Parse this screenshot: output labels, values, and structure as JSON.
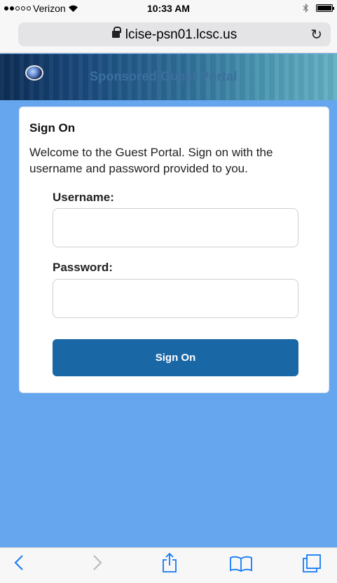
{
  "status_bar": {
    "carrier": "Verizon",
    "time": "10:33 AM"
  },
  "browser": {
    "url": "lcise-psn01.lcsc.us"
  },
  "portal": {
    "title": "Sponsored Guest Portal"
  },
  "signon": {
    "heading": "Sign On",
    "welcome": "Welcome to the Guest Portal. Sign on with the username and password provided to you.",
    "username_label": "Username:",
    "username_value": "",
    "password_label": "Password:",
    "password_value": "",
    "button_label": "Sign On"
  },
  "colors": {
    "page_background": "#66a6ee",
    "button": "#1a67a6",
    "toolbar_icon": "#1479f5"
  },
  "toolbar": {
    "icons": [
      "back-icon",
      "forward-icon",
      "share-icon",
      "bookmarks-icon",
      "tabs-icon"
    ]
  }
}
